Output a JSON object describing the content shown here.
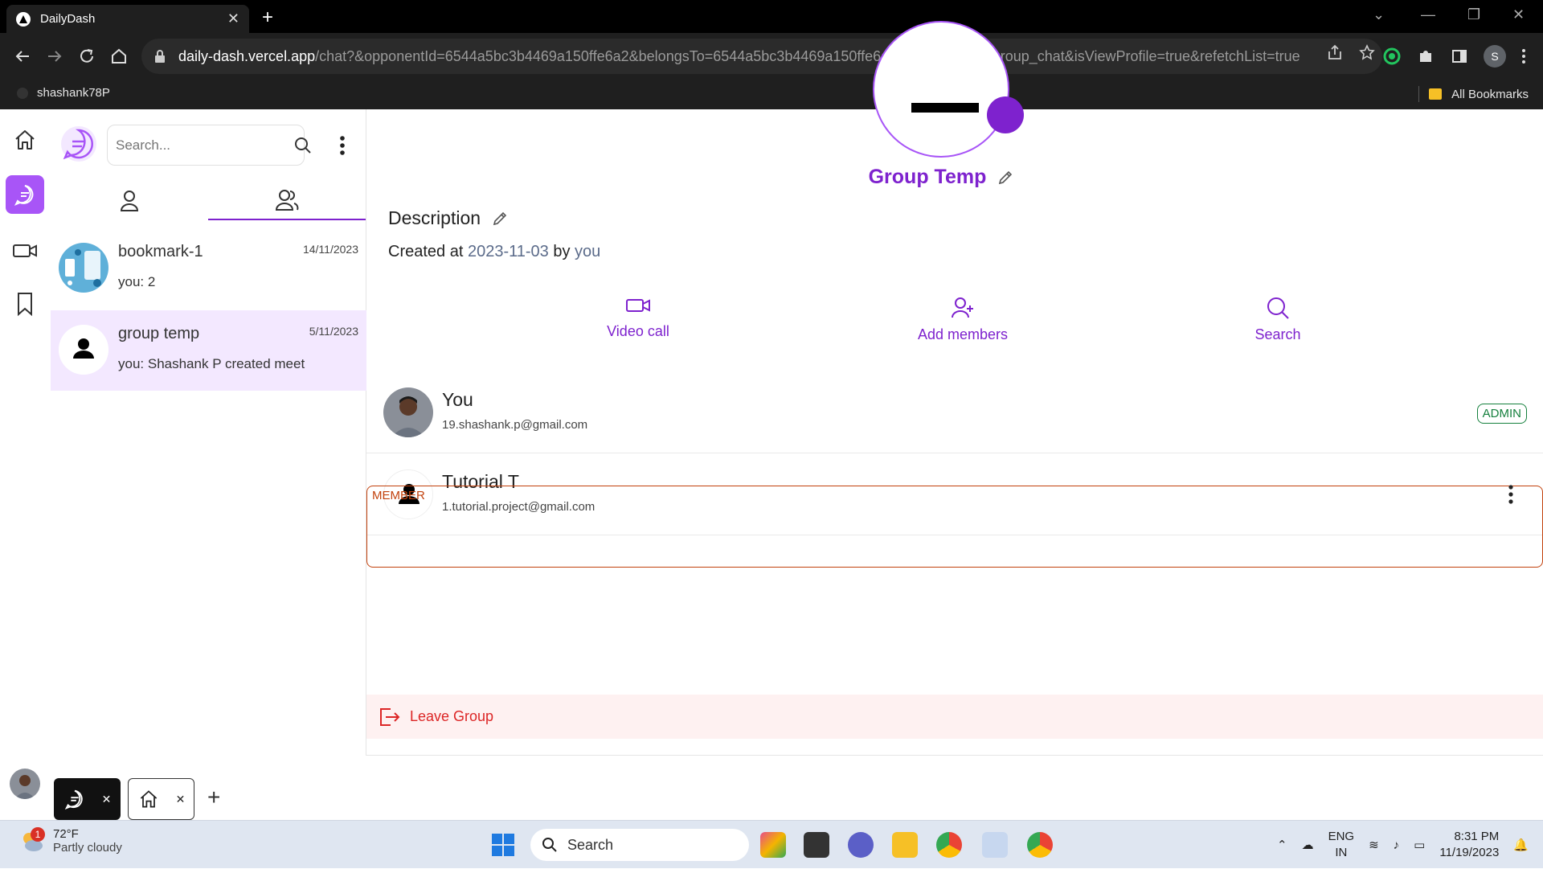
{
  "browser": {
    "tab_title": "DailyDash",
    "url_host": "daily-dash.vercel.app",
    "url_path": "/chat?&opponentId=6544a5bc3b4469a150ffe6a2&belongsTo=6544a5bc3b4469a150ffe6a2&selectedTab=group_chat&isViewProfile=true&refetchList=true",
    "profile_initial": "S",
    "bookmark_left": "shashank78P",
    "bookmark_right": "All Bookmarks"
  },
  "sidebar": {
    "search_placeholder": "Search...",
    "chats": [
      {
        "name": "bookmark-1",
        "last_message": "you: 2",
        "date": "14/11/2023"
      },
      {
        "name": "group temp",
        "last_message": "you: Shashank P created meet",
        "date": "5/11/2023"
      }
    ]
  },
  "profile": {
    "group_name": "Group Temp",
    "description_label": "Description",
    "created_prefix": "Created at",
    "created_date": "2023-11-03",
    "created_by_prefix": "by",
    "created_by": "you",
    "actions": [
      {
        "label": "Video call",
        "icon": "video-icon"
      },
      {
        "label": "Add members",
        "icon": "add-user-icon"
      },
      {
        "label": "Search",
        "icon": "search-icon"
      }
    ],
    "members": [
      {
        "name": "You",
        "email": "19.shashank.p@gmail.com",
        "role": "ADMIN"
      },
      {
        "name": "Tutorial T",
        "email": "1.tutorial.project@gmail.com",
        "role": "MEMBER"
      }
    ],
    "leave_label": "Leave Group"
  },
  "taskbar": {
    "temperature": "72°F",
    "weather": "Partly cloudy",
    "weather_badge": "1",
    "search_label": "Search",
    "lang_top": "ENG",
    "lang_bottom": "IN",
    "time": "8:31 PM",
    "date": "11/19/2023"
  },
  "colors": {
    "accent": "#7e22ce",
    "accent_light": "#a855f7",
    "selected_chat_bg": "#f3e8ff",
    "admin": "#15803d",
    "member": "#c2410c",
    "leave": "#dc2626"
  }
}
